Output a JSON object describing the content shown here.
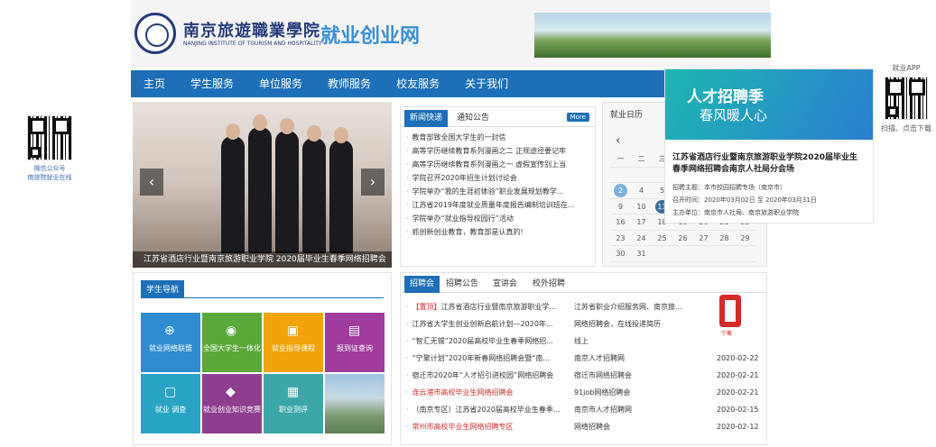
{
  "left_qr": {
    "caption1": "微信公众号",
    "caption2": "南旅院就业在线"
  },
  "app": {
    "title": "就业APP",
    "caption": "扫描、点击下载"
  },
  "header": {
    "school_cn": "南京旅遊職業學院",
    "school_en": "NANJING INSTITUTE OF TOURISM AND HOSPITALITY",
    "site_title": "就业创业网"
  },
  "nav": [
    "主页",
    "学生服务",
    "单位服务",
    "教师服务",
    "校友服务",
    "关于我们"
  ],
  "ad": {
    "banner_line1": "人才招聘季",
    "banner_line2": "春风暖人心",
    "title": "江苏省酒店行业暨南京旅游职业学院2020届毕业生春季网络招聘会南京人社局分会场",
    "theme": "招聘主题：本市校园招聘专场（南京市）",
    "time": "召开时间：2020年03月02日 至 2020年03月31日",
    "host": "主办单位：南京市人社局、南京旅游职业学院"
  },
  "slider": {
    "caption": "江苏省酒店行业暨南京旅游职业学院 2020届毕业生春季网络招聘会",
    "prev": "‹",
    "next": "›"
  },
  "news": {
    "tab_active": "新闻快递",
    "tab_other": "通知公告",
    "more": "More",
    "items": [
      "教育部致全国大学生的一封信",
      "高等学历继续教育系列漫画之二 正规途径要记牢",
      "高等学历继续教育系列漫画之一 虚假宣传别上当",
      "学院召开2020年招生计划讨论会",
      "学院举办“我的生涯初体验”职业发展规划教学...",
      "江苏省2019年度就业质量年度报告编制培训班在...",
      "学院举办“就业指导校园行”活动",
      "抓创新创业教育，教育部是认真的!"
    ]
  },
  "calendar": {
    "title": "就业日历",
    "prev": "‹",
    "weekdays": [
      "一",
      "二",
      "三",
      "四",
      "五",
      "六",
      "日"
    ],
    "days": [
      "",
      "",
      "",
      "",
      "",
      "1",
      "",
      "2",
      "4",
      "5",
      "6",
      "7",
      "8",
      "",
      "9",
      "10",
      "11",
      "12",
      "13",
      "14",
      "15",
      "16",
      "17",
      "18",
      "19",
      "20",
      "21",
      "22",
      "23",
      "24",
      "25",
      "26",
      "27",
      "28",
      "29",
      "30",
      "31",
      "",
      "",
      "",
      "",
      ""
    ]
  },
  "student_nav": {
    "title": "学生导航",
    "tiles": [
      {
        "label": "就业网络联盟",
        "icon": "⊕",
        "color": "#2e8ccf"
      },
      {
        "label": "全国大学生一体化",
        "icon": "◉",
        "color": "#5aa83a"
      },
      {
        "label": "就业指导课程",
        "icon": "▣",
        "color": "#f0a30a"
      },
      {
        "label": "报到证查询",
        "icon": "▤",
        "color": "#a03c9c"
      },
      {
        "label": "就业 调查",
        "icon": "▢",
        "color": "#2aa4c4"
      },
      {
        "label": "就业创业知识竞赛",
        "icon": "◆",
        "color": "#8e3e8f"
      },
      {
        "label": "职业测评",
        "icon": "▦",
        "color": "#3ba7a8"
      }
    ]
  },
  "recruit": {
    "tabs": [
      "招聘会",
      "招聘公告",
      "宣讲会",
      "校外招聘"
    ],
    "logo_text": "宁聚",
    "rows": [
      {
        "prefix": "【置顶】",
        "title": "江苏省酒店行业暨南京旅游职业学...",
        "source": "江苏省职业介绍服务网、南京旅...",
        "date": ""
      },
      {
        "prefix": "",
        "title": "江苏省大学生创业创新启航计划—2020年...",
        "source": "网络招聘会，在线投递简历",
        "date": ""
      },
      {
        "prefix": "",
        "title": "“智汇无锡”2020届高校毕业生春季网络招...",
        "source": "线上",
        "date": ""
      },
      {
        "prefix": "",
        "title": "“宁聚计划”2020年新春网络招聘会暨“南...",
        "source": "南京人才招聘网",
        "date": "2020-02-22"
      },
      {
        "prefix": "",
        "title": "宿迁市2020年“人才招引进校园”网络招聘会",
        "source": "宿迁市网络招聘会",
        "date": "2020-02-21"
      },
      {
        "prefix": "",
        "title": "连云港市高校毕业生网络招聘会",
        "source": "91job网络招聘会",
        "date": "2020-02-21",
        "red": true
      },
      {
        "prefix": "",
        "title": "（南京专区）江苏省2020届高校毕业生春季...",
        "source": "南京市人才招聘网",
        "date": "2020-02-15"
      },
      {
        "prefix": "",
        "title": "常州市高校毕业生网络招聘专区",
        "source": "网络招聘会",
        "date": "2020-02-12",
        "red": true
      }
    ]
  }
}
